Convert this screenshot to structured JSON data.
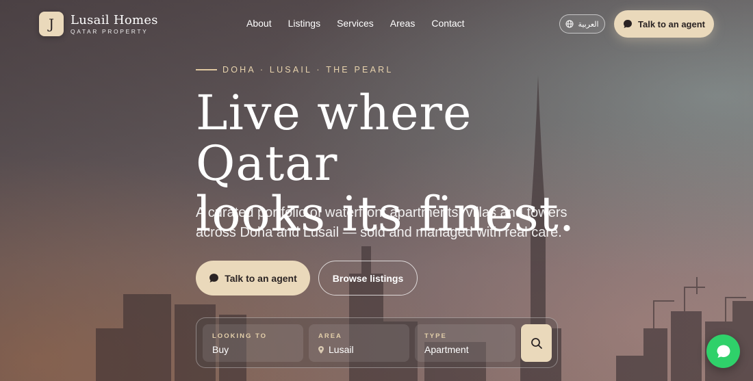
{
  "brand": {
    "badge": "J",
    "name": "Lusail Homes",
    "tagline": "QATAR PROPERTY"
  },
  "nav": {
    "links": [
      "About",
      "Listings",
      "Services",
      "Areas",
      "Contact"
    ],
    "language_label": "العربية",
    "agent_button": "Talk to an agent"
  },
  "hero": {
    "eyebrow": "DOHA · LUSAIL · THE PEARL",
    "headline_line1": "Live where Qatar",
    "headline_line2": "looks its finest.",
    "lede": "A curated portfolio of waterfront apartments, villas and towers across Doha and Lusail — sold and managed with real care.",
    "primary_cta": "Talk to an agent",
    "secondary_cta": "Browse listings"
  },
  "search": {
    "fields": [
      {
        "label": "LOOKING TO",
        "value": "Buy"
      },
      {
        "label": "AREA",
        "value": "Lusail"
      },
      {
        "label": "TYPE",
        "value": "Apartment"
      }
    ]
  },
  "colors": {
    "accent": "#ead9bb",
    "accent_text": "#2a2323",
    "chat": "#2fd16a"
  },
  "icons": {
    "lang": "globe-icon",
    "agent": "chat-bubble-icon",
    "area": "map-pin-icon",
    "search": "search-icon",
    "fab": "whatsapp-icon"
  }
}
